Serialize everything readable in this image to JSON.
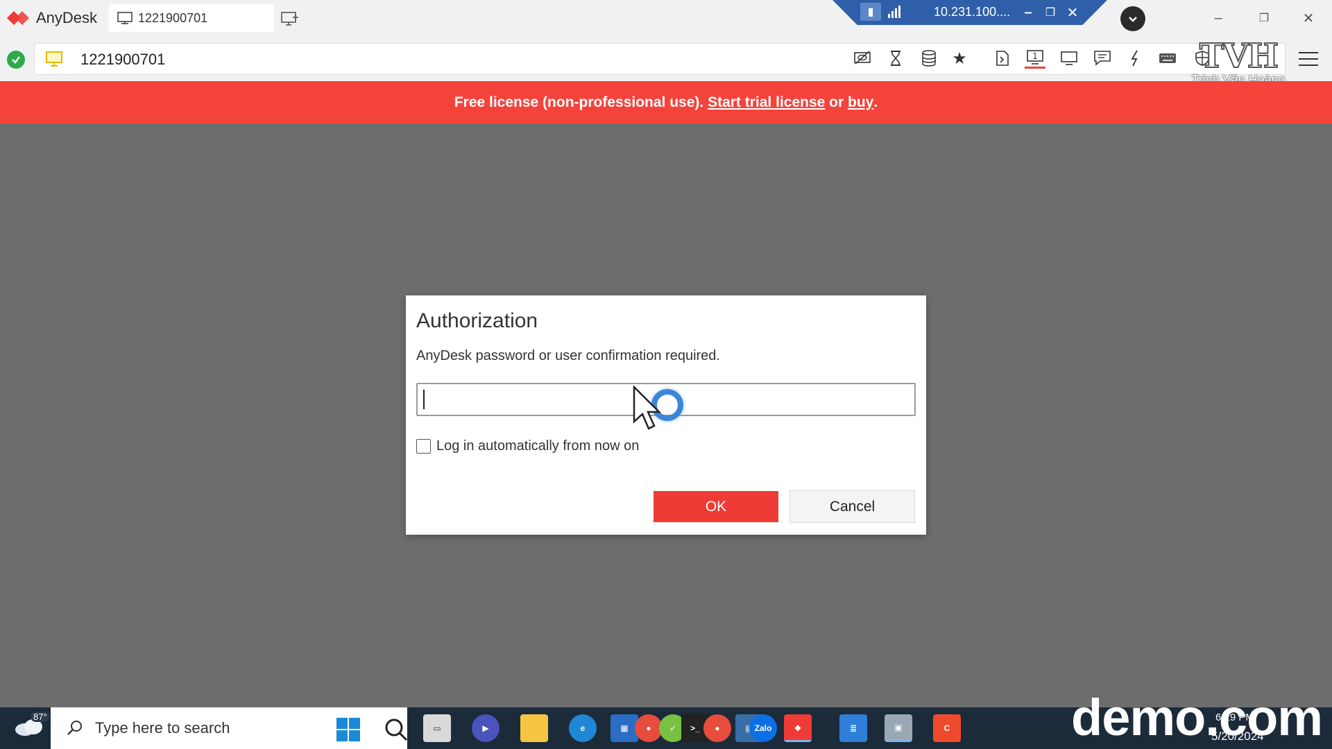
{
  "app": {
    "name": "AnyDesk",
    "session_tab_label": "1221900701"
  },
  "remote_bar": {
    "ip": "10.231.100...."
  },
  "address_bar": {
    "value": "1221900701"
  },
  "toolbar_icons": [
    "privacy-icon",
    "hourglass-icon",
    "database-icon",
    "star-icon",
    "file-transfer-icon",
    "monitor-1-icon",
    "display-icon",
    "chat-icon",
    "lightning-icon",
    "keyboard-icon",
    "shield-icon"
  ],
  "watermark": {
    "logo": "TVH",
    "name": "Trịnh Văn Hoàng"
  },
  "banner": {
    "prefix": "Free license (non-professional use). ",
    "trial_link": "Start trial license",
    "middle": " or ",
    "buy_link": "buy",
    "suffix": "."
  },
  "dialog": {
    "title": "Authorization",
    "message": "AnyDesk password or user confirmation required.",
    "password_value": "",
    "auto_login_label": "Log in automatically from now on",
    "auto_login_checked": false,
    "ok_label": "OK",
    "cancel_label": "Cancel"
  },
  "taskbar": {
    "weather_temp": "87°",
    "search_placeholder": "Type here to search",
    "date": "5/20/2024",
    "time": "6:19 PM"
  },
  "overlay_watermark": "demo.com",
  "colors": {
    "brand_red": "#ef3b36",
    "banner_red": "#f4433b",
    "remote_bar_blue": "#2f5fa8",
    "ok_green": "#2eaa4a",
    "taskbar": "#1c2b3a"
  }
}
